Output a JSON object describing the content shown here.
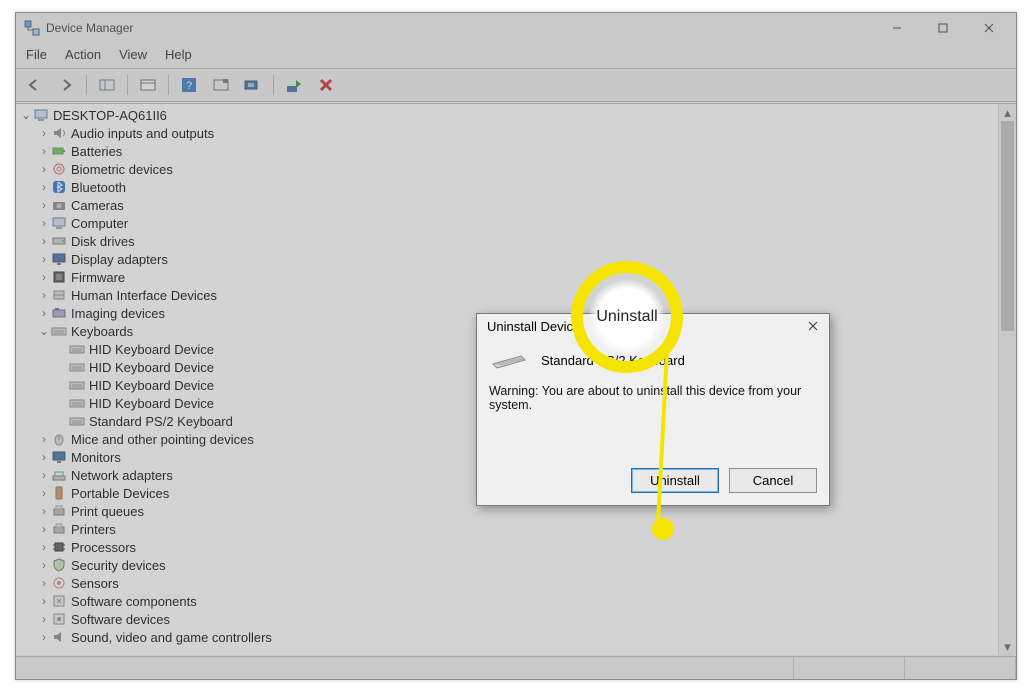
{
  "window": {
    "title": "Device Manager",
    "menu": {
      "file": "File",
      "action": "Action",
      "view": "View",
      "help": "Help"
    },
    "root_node": "DESKTOP-AQ61II6"
  },
  "categories": [
    {
      "label": "Audio inputs and outputs",
      "icon": "audio"
    },
    {
      "label": "Batteries",
      "icon": "battery"
    },
    {
      "label": "Biometric devices",
      "icon": "biometric"
    },
    {
      "label": "Bluetooth",
      "icon": "bluetooth"
    },
    {
      "label": "Cameras",
      "icon": "camera"
    },
    {
      "label": "Computer",
      "icon": "computer"
    },
    {
      "label": "Disk drives",
      "icon": "disk"
    },
    {
      "label": "Display adapters",
      "icon": "display"
    },
    {
      "label": "Firmware",
      "icon": "firmware"
    },
    {
      "label": "Human Interface Devices",
      "icon": "hid"
    },
    {
      "label": "Imaging devices",
      "icon": "imaging"
    }
  ],
  "keyboards": {
    "label": "Keyboards",
    "items": [
      "HID Keyboard Device",
      "HID Keyboard Device",
      "HID Keyboard Device",
      "HID Keyboard Device",
      "Standard PS/2 Keyboard"
    ]
  },
  "categories2": [
    {
      "label": "Mice and other pointing devices",
      "icon": "mouse"
    },
    {
      "label": "Monitors",
      "icon": "monitor"
    },
    {
      "label": "Network adapters",
      "icon": "network"
    },
    {
      "label": "Portable Devices",
      "icon": "portable"
    },
    {
      "label": "Print queues",
      "icon": "printq"
    },
    {
      "label": "Printers",
      "icon": "printer"
    },
    {
      "label": "Processors",
      "icon": "cpu"
    },
    {
      "label": "Security devices",
      "icon": "security"
    },
    {
      "label": "Sensors",
      "icon": "sensor"
    },
    {
      "label": "Software components",
      "icon": "swcomp"
    },
    {
      "label": "Software devices",
      "icon": "swdev"
    },
    {
      "label": "Sound, video and game controllers",
      "icon": "sound"
    }
  ],
  "dialog": {
    "title": "Uninstall Device",
    "device": "Standard PS/2 Keyboard",
    "warning": "Warning: You are about to uninstall this device from your system.",
    "uninstall": "Uninstall",
    "cancel": "Cancel"
  },
  "callout": {
    "label": "Uninstall"
  }
}
